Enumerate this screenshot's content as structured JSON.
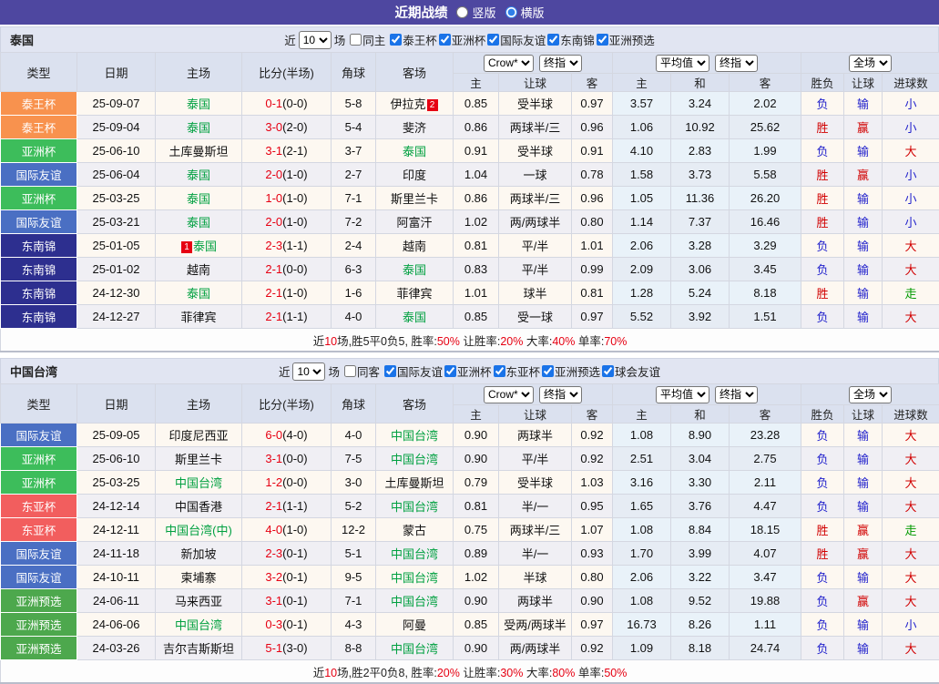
{
  "header": {
    "title": "近期战绩",
    "radios": [
      {
        "label": "竖版",
        "checked": false
      },
      {
        "label": "横版",
        "checked": true
      }
    ]
  },
  "table_header": {
    "main": [
      "类型",
      "日期",
      "主场",
      "比分(半场)",
      "角球",
      "客场"
    ],
    "sub": [
      "主",
      "让球",
      "客",
      "主",
      "和",
      "客",
      "胜负",
      "让球",
      "进球数"
    ],
    "selects": {
      "company": "Crow*",
      "stage1": "终指",
      "avg": "平均值",
      "stage2": "终指",
      "scope": "全场"
    }
  },
  "colors": {
    "topbar_bg": "#4e47a0",
    "section_bar_bg": "#e1e5f2",
    "header_bg": "#dbe1ef",
    "row_odd": "#fdf8f1",
    "row_even": "#f0eff4",
    "avg_odd": "#e9f2f9",
    "avg_even": "#e6ecf4",
    "team_green": "#00a040",
    "score_red": "#e60012",
    "badge_red": "#e60012",
    "summary_red": "#e60012",
    "type_colors": {
      "泰王杯": "#f8924e",
      "亚洲杯": "#3dbd5b",
      "国际友谊": "#4a6fc3",
      "东南锦": "#2d2f8f",
      "东亚杯": "#f25e5e",
      "亚洲预选": "#4da84d"
    },
    "result_colors": {
      "胜": "#d10000",
      "负": "#2222cc",
      "赢": "#d10000",
      "输": "#2222cc",
      "大": "#d10000",
      "小": "#2222cc",
      "走": "#009900"
    }
  },
  "sections": [
    {
      "team": "泰国",
      "filter": {
        "near_label": "近",
        "count": "10",
        "unit": "场",
        "same_label": "同主",
        "same_checked": false,
        "competitions": [
          {
            "label": "泰王杯",
            "checked": true
          },
          {
            "label": "亚洲杯",
            "checked": true
          },
          {
            "label": "国际友谊",
            "checked": true
          },
          {
            "label": "东南锦",
            "checked": true
          },
          {
            "label": "亚洲预选",
            "checked": true
          }
        ]
      },
      "rows": [
        {
          "type": "泰王杯",
          "date": "25-09-07",
          "home": {
            "n": "泰国",
            "g": 1
          },
          "ft": "0-1",
          "ht": "(0-0)",
          "cr": "5-8",
          "away": {
            "n": "伊拉克",
            "post": "2"
          },
          "od": [
            "0.85",
            "受半球",
            "0.97"
          ],
          "avg": [
            "3.57",
            "3.24",
            "2.02"
          ],
          "res": [
            "负",
            "输",
            "小"
          ]
        },
        {
          "type": "泰王杯",
          "date": "25-09-04",
          "home": {
            "n": "泰国",
            "g": 1
          },
          "ft": "3-0",
          "ht": "(2-0)",
          "cr": "5-4",
          "away": {
            "n": "斐济"
          },
          "od": [
            "0.86",
            "两球半/三",
            "0.96"
          ],
          "avg": [
            "1.06",
            "10.92",
            "25.62"
          ],
          "res": [
            "胜",
            "赢",
            "小"
          ]
        },
        {
          "type": "亚洲杯",
          "date": "25-06-10",
          "home": {
            "n": "土库曼斯坦"
          },
          "ft": "3-1",
          "ht": "(2-1)",
          "cr": "3-7",
          "away": {
            "n": "泰国",
            "g": 1
          },
          "od": [
            "0.91",
            "受半球",
            "0.91"
          ],
          "avg": [
            "4.10",
            "2.83",
            "1.99"
          ],
          "res": [
            "负",
            "输",
            "大"
          ]
        },
        {
          "type": "国际友谊",
          "date": "25-06-04",
          "home": {
            "n": "泰国",
            "g": 1
          },
          "ft": "2-0",
          "ht": "(1-0)",
          "cr": "2-7",
          "away": {
            "n": "印度"
          },
          "od": [
            "1.04",
            "一球",
            "0.78"
          ],
          "avg": [
            "1.58",
            "3.73",
            "5.58"
          ],
          "res": [
            "胜",
            "赢",
            "小"
          ]
        },
        {
          "type": "亚洲杯",
          "date": "25-03-25",
          "home": {
            "n": "泰国",
            "g": 1
          },
          "ft": "1-0",
          "ht": "(1-0)",
          "cr": "7-1",
          "away": {
            "n": "斯里兰卡"
          },
          "od": [
            "0.86",
            "两球半/三",
            "0.96"
          ],
          "avg": [
            "1.05",
            "11.36",
            "26.20"
          ],
          "res": [
            "胜",
            "输",
            "小"
          ]
        },
        {
          "type": "国际友谊",
          "date": "25-03-21",
          "home": {
            "n": "泰国",
            "g": 1
          },
          "ft": "2-0",
          "ht": "(1-0)",
          "cr": "7-2",
          "away": {
            "n": "阿富汗"
          },
          "od": [
            "1.02",
            "两/两球半",
            "0.80"
          ],
          "avg": [
            "1.14",
            "7.37",
            "16.46"
          ],
          "res": [
            "胜",
            "输",
            "小"
          ]
        },
        {
          "type": "东南锦",
          "date": "25-01-05",
          "home": {
            "pre": "1",
            "n": "泰国",
            "g": 1
          },
          "ft": "2-3",
          "ht": "(1-1)",
          "cr": "2-4",
          "away": {
            "n": "越南"
          },
          "od": [
            "0.81",
            "平/半",
            "1.01"
          ],
          "avg": [
            "2.06",
            "3.28",
            "3.29"
          ],
          "res": [
            "负",
            "输",
            "大"
          ]
        },
        {
          "type": "东南锦",
          "date": "25-01-02",
          "home": {
            "n": "越南"
          },
          "ft": "2-1",
          "ht": "(0-0)",
          "cr": "6-3",
          "away": {
            "n": "泰国",
            "g": 1
          },
          "od": [
            "0.83",
            "平/半",
            "0.99"
          ],
          "avg": [
            "2.09",
            "3.06",
            "3.45"
          ],
          "res": [
            "负",
            "输",
            "大"
          ]
        },
        {
          "type": "东南锦",
          "date": "24-12-30",
          "home": {
            "n": "泰国",
            "g": 1
          },
          "ft": "2-1",
          "ht": "(1-0)",
          "cr": "1-6",
          "away": {
            "n": "菲律宾"
          },
          "od": [
            "1.01",
            "球半",
            "0.81"
          ],
          "avg": [
            "1.28",
            "5.24",
            "8.18"
          ],
          "res": [
            "胜",
            "输",
            "走"
          ]
        },
        {
          "type": "东南锦",
          "date": "24-12-27",
          "home": {
            "n": "菲律宾"
          },
          "ft": "2-1",
          "ht": "(1-1)",
          "cr": "4-0",
          "away": {
            "n": "泰国",
            "g": 1
          },
          "od": [
            "0.85",
            "受一球",
            "0.97"
          ],
          "avg": [
            "5.52",
            "3.92",
            "1.51"
          ],
          "res": [
            "负",
            "输",
            "大"
          ]
        }
      ],
      "summary": [
        {
          "t": "近",
          "r": 0
        },
        {
          "t": "10",
          "r": 1
        },
        {
          "t": "场,胜5平0负5, 胜率:",
          "r": 0
        },
        {
          "t": "50%",
          "r": 1
        },
        {
          "t": " 让胜率:",
          "r": 0
        },
        {
          "t": "20%",
          "r": 1
        },
        {
          "t": " 大率:",
          "r": 0
        },
        {
          "t": "40%",
          "r": 1
        },
        {
          "t": " 单率:",
          "r": 0
        },
        {
          "t": "70%",
          "r": 1
        }
      ]
    },
    {
      "team": "中国台湾",
      "filter": {
        "near_label": "近",
        "count": "10",
        "unit": "场",
        "same_label": "同客",
        "same_checked": false,
        "competitions": [
          {
            "label": "国际友谊",
            "checked": true
          },
          {
            "label": "亚洲杯",
            "checked": true
          },
          {
            "label": "东亚杯",
            "checked": true
          },
          {
            "label": "亚洲预选",
            "checked": true
          },
          {
            "label": "球会友谊",
            "checked": true
          }
        ]
      },
      "rows": [
        {
          "type": "国际友谊",
          "date": "25-09-05",
          "home": {
            "n": "印度尼西亚"
          },
          "ft": "6-0",
          "ht": "(4-0)",
          "cr": "4-0",
          "away": {
            "n": "中国台湾",
            "g": 1
          },
          "od": [
            "0.90",
            "两球半",
            "0.92"
          ],
          "avg": [
            "1.08",
            "8.90",
            "23.28"
          ],
          "res": [
            "负",
            "输",
            "大"
          ]
        },
        {
          "type": "亚洲杯",
          "date": "25-06-10",
          "home": {
            "n": "斯里兰卡"
          },
          "ft": "3-1",
          "ht": "(0-0)",
          "cr": "7-5",
          "away": {
            "n": "中国台湾",
            "g": 1
          },
          "od": [
            "0.90",
            "平/半",
            "0.92"
          ],
          "avg": [
            "2.51",
            "3.04",
            "2.75"
          ],
          "res": [
            "负",
            "输",
            "大"
          ]
        },
        {
          "type": "亚洲杯",
          "date": "25-03-25",
          "home": {
            "n": "中国台湾",
            "g": 1
          },
          "ft": "1-2",
          "ht": "(0-0)",
          "cr": "3-0",
          "away": {
            "n": "土库曼斯坦"
          },
          "od": [
            "0.79",
            "受半球",
            "1.03"
          ],
          "avg": [
            "3.16",
            "3.30",
            "2.11"
          ],
          "res": [
            "负",
            "输",
            "大"
          ]
        },
        {
          "type": "东亚杯",
          "date": "24-12-14",
          "home": {
            "n": "中国香港"
          },
          "ft": "2-1",
          "ht": "(1-1)",
          "cr": "5-2",
          "away": {
            "n": "中国台湾",
            "g": 1
          },
          "od": [
            "0.81",
            "半/一",
            "0.95"
          ],
          "avg": [
            "1.65",
            "3.76",
            "4.47"
          ],
          "res": [
            "负",
            "输",
            "大"
          ]
        },
        {
          "type": "东亚杯",
          "date": "24-12-11",
          "home": {
            "n": "中国台湾(中)",
            "g": 1
          },
          "ft": "4-0",
          "ht": "(1-0)",
          "cr": "12-2",
          "away": {
            "n": "蒙古"
          },
          "od": [
            "0.75",
            "两球半/三",
            "1.07"
          ],
          "avg": [
            "1.08",
            "8.84",
            "18.15"
          ],
          "res": [
            "胜",
            "赢",
            "走"
          ]
        },
        {
          "type": "国际友谊",
          "date": "24-11-18",
          "home": {
            "n": "新加坡"
          },
          "ft": "2-3",
          "ht": "(0-1)",
          "cr": "5-1",
          "away": {
            "n": "中国台湾",
            "g": 1
          },
          "od": [
            "0.89",
            "半/一",
            "0.93"
          ],
          "avg": [
            "1.70",
            "3.99",
            "4.07"
          ],
          "res": [
            "胜",
            "赢",
            "大"
          ]
        },
        {
          "type": "国际友谊",
          "date": "24-10-11",
          "home": {
            "n": "柬埔寨"
          },
          "ft": "3-2",
          "ht": "(0-1)",
          "cr": "9-5",
          "away": {
            "n": "中国台湾",
            "g": 1
          },
          "od": [
            "1.02",
            "半球",
            "0.80"
          ],
          "avg": [
            "2.06",
            "3.22",
            "3.47"
          ],
          "res": [
            "负",
            "输",
            "大"
          ]
        },
        {
          "type": "亚洲预选",
          "date": "24-06-11",
          "home": {
            "n": "马来西亚"
          },
          "ft": "3-1",
          "ht": "(0-1)",
          "cr": "7-1",
          "away": {
            "n": "中国台湾",
            "g": 1
          },
          "od": [
            "0.90",
            "两球半",
            "0.90"
          ],
          "avg": [
            "1.08",
            "9.52",
            "19.88"
          ],
          "res": [
            "负",
            "赢",
            "大"
          ]
        },
        {
          "type": "亚洲预选",
          "date": "24-06-06",
          "home": {
            "n": "中国台湾",
            "g": 1
          },
          "ft": "0-3",
          "ht": "(0-1)",
          "cr": "4-3",
          "away": {
            "n": "阿曼"
          },
          "od": [
            "0.85",
            "受两/两球半",
            "0.97"
          ],
          "avg": [
            "16.73",
            "8.26",
            "1.11"
          ],
          "res": [
            "负",
            "输",
            "小"
          ]
        },
        {
          "type": "亚洲预选",
          "date": "24-03-26",
          "home": {
            "n": "吉尔吉斯斯坦"
          },
          "ft": "5-1",
          "ht": "(3-0)",
          "cr": "8-8",
          "away": {
            "n": "中国台湾",
            "g": 1
          },
          "od": [
            "0.90",
            "两/两球半",
            "0.92"
          ],
          "avg": [
            "1.09",
            "8.18",
            "24.74"
          ],
          "res": [
            "负",
            "输",
            "大"
          ]
        }
      ],
      "summary": [
        {
          "t": "近",
          "r": 0
        },
        {
          "t": "10",
          "r": 1
        },
        {
          "t": "场,胜2平0负8, 胜率:",
          "r": 0
        },
        {
          "t": "20%",
          "r": 1
        },
        {
          "t": " 让胜率:",
          "r": 0
        },
        {
          "t": "30%",
          "r": 1
        },
        {
          "t": " 大率:",
          "r": 0
        },
        {
          "t": "80%",
          "r": 1
        },
        {
          "t": " 单率:",
          "r": 0
        },
        {
          "t": "50%",
          "r": 1
        }
      ]
    }
  ]
}
